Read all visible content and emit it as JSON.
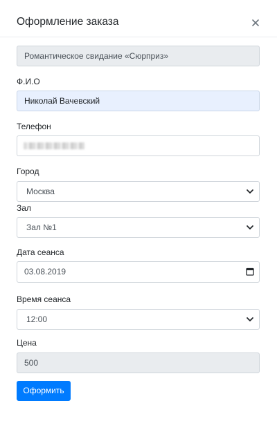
{
  "modal": {
    "title": "Оформление заказа",
    "close_symbol": "×"
  },
  "form": {
    "product": {
      "value": "Романтическое свидание «Сюрприз»"
    },
    "name": {
      "label": "Ф.И.О",
      "value": "Николай Вачевский"
    },
    "phone": {
      "label": "Телефон",
      "value_obscured": true
    },
    "city": {
      "label": "Город",
      "value": "Москва"
    },
    "hall": {
      "label": "Зал",
      "value": "Зал №1"
    },
    "date": {
      "label": "Дата сеанса",
      "value": "03.08.2019"
    },
    "time": {
      "label": "Время сеанса",
      "value": "12:00"
    },
    "price": {
      "label": "Цена",
      "value": "500"
    },
    "submit_label": "Оформить"
  },
  "icons": {
    "close": "close-icon",
    "select_arrow": "chevron-down-icon",
    "calendar": "calendar-icon"
  },
  "colors": {
    "primary": "#007bff",
    "readonly_bg": "#e9ecef",
    "autofill_bg": "#e8f0fe",
    "border": "#ced4da"
  }
}
